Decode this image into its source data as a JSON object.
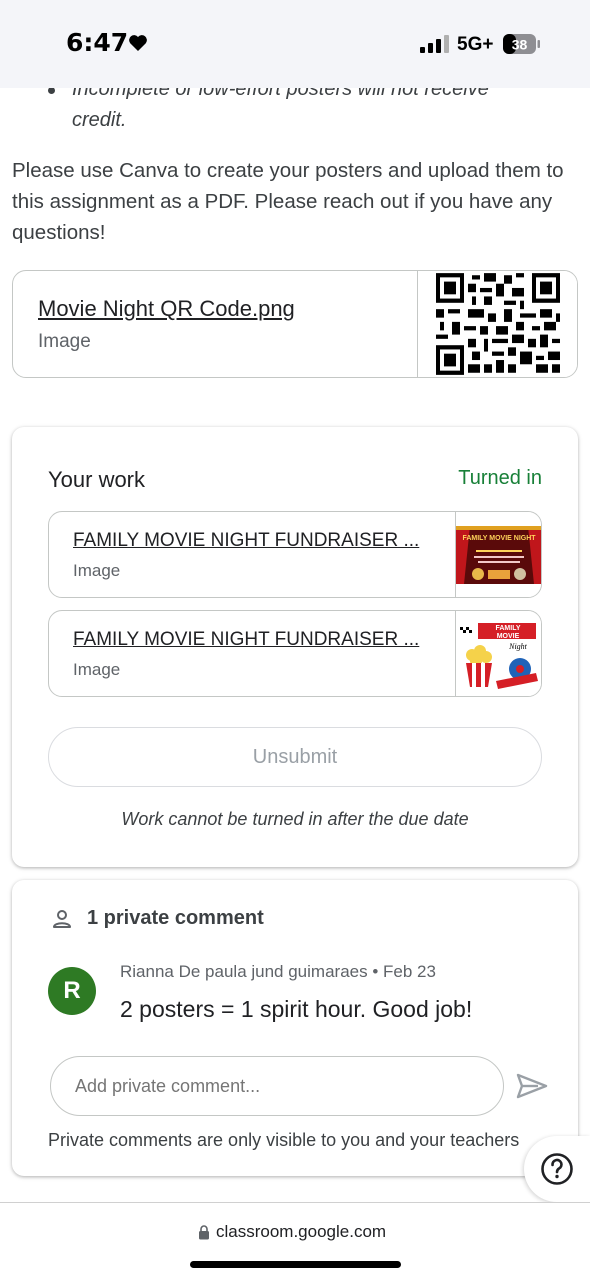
{
  "status_bar": {
    "time": "6:47",
    "network": "5G+",
    "battery": "38"
  },
  "instructions": {
    "bullet": "Incomplete or low-effort posters will not receive credit.",
    "body": "Please use Canva to create your posters and upload them to this assignment as a PDF. Please reach out if you have any questions!"
  },
  "attachment": {
    "title": "Movie Night QR Code.png",
    "type": "Image"
  },
  "your_work": {
    "title": "Your work",
    "status": "Turned in",
    "files": [
      {
        "title": "FAMILY MOVIE NIGHT FUNDRAISER ...",
        "type": "Image",
        "thumb_text": "FAMILY MOVIE NIGHT"
      },
      {
        "title": "FAMILY MOVIE NIGHT FUNDRAISER ...",
        "type": "Image",
        "thumb_text_1": "FAMILY",
        "thumb_text_2": "MOVIE",
        "thumb_text_3": "Night"
      }
    ],
    "unsubmit_label": "Unsubmit",
    "due_note": "Work cannot be turned in after the due date"
  },
  "comments": {
    "header": "1 private comment",
    "items": [
      {
        "avatar_letter": "R",
        "author": "Rianna De paula jund guimaraes",
        "date": "Feb 23",
        "author_line": "Rianna De paula jund guimaraes • Feb 23",
        "text": "2 posters = 1 spirit hour. Good job!"
      }
    ],
    "input_placeholder": "Add private comment...",
    "note": "Private comments are only visible to you and your teachers"
  },
  "browser": {
    "url": "classroom.google.com"
  },
  "colors": {
    "turned_in": "#188038",
    "avatar": "#2e7a24",
    "status_bar_bg": "#f4f5f9"
  }
}
